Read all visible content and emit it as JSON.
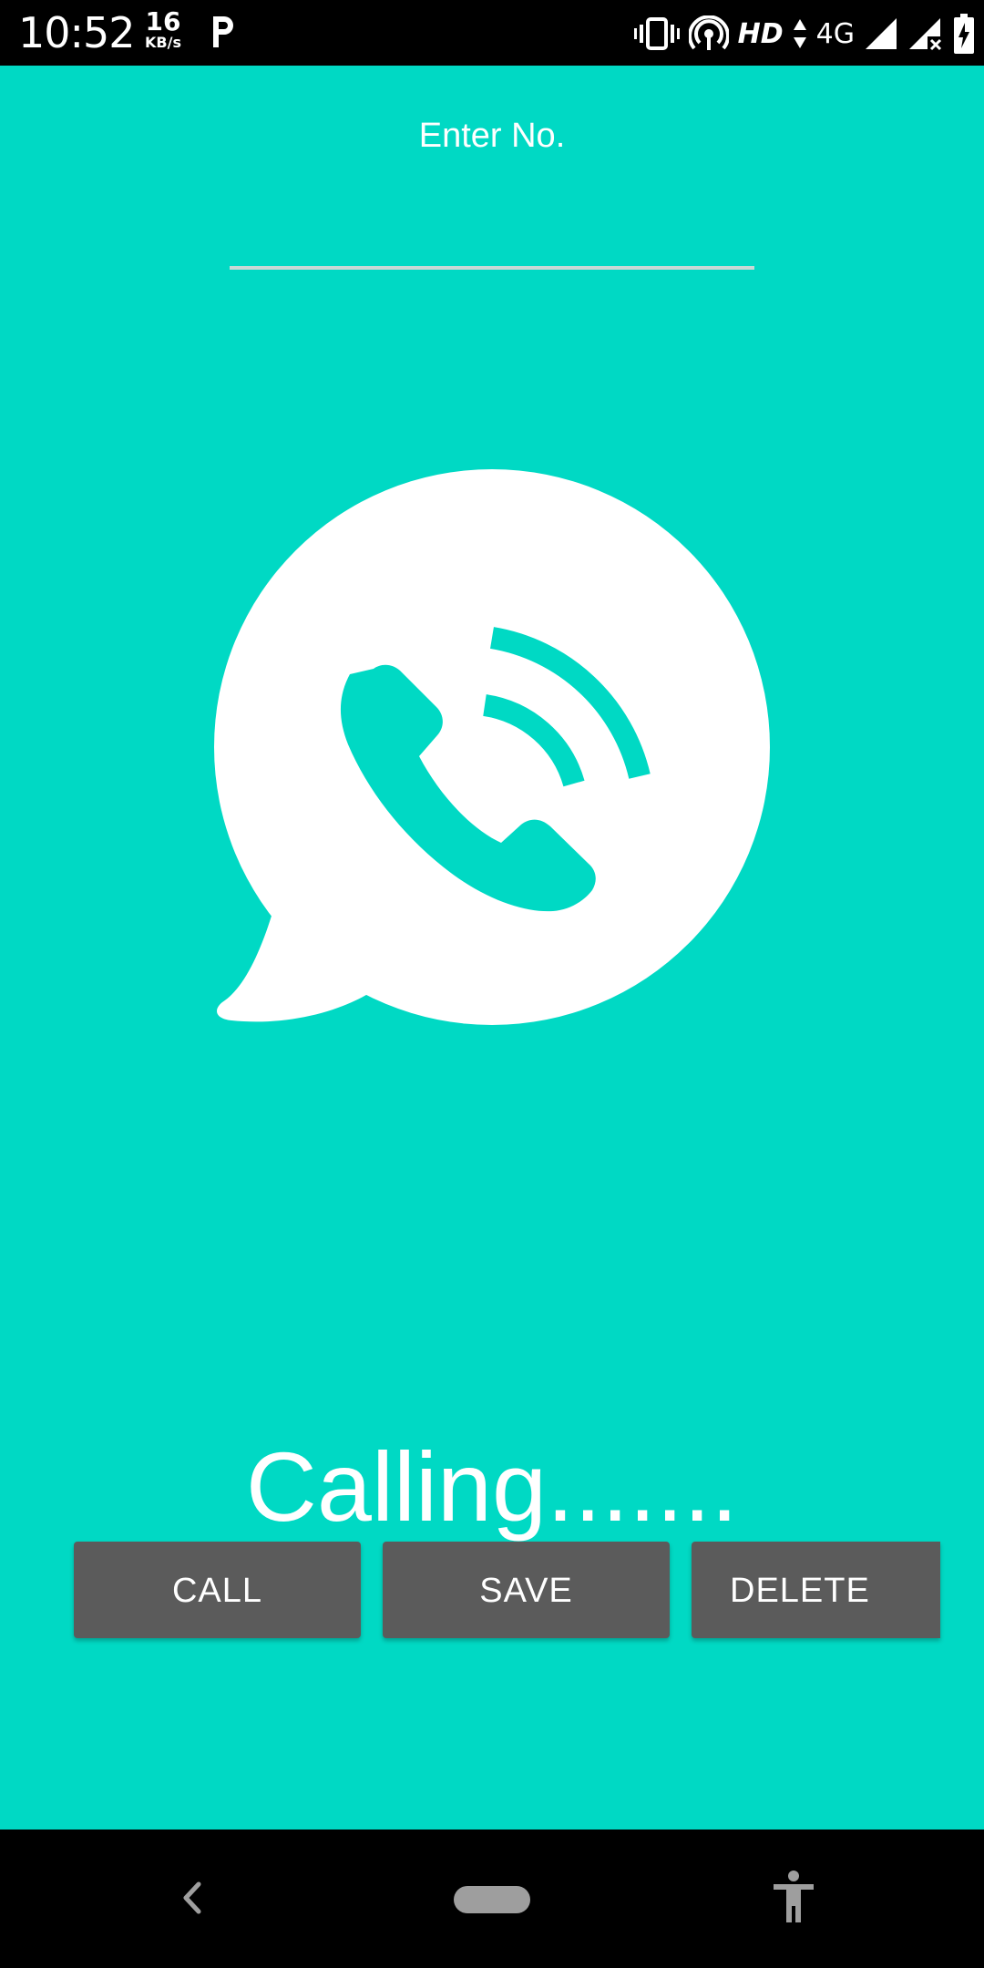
{
  "status_bar": {
    "time": "10:52",
    "net_speed_value": "16",
    "net_speed_unit": "KB/s",
    "hd_label": "HD",
    "network_label": "4G",
    "icons": [
      "p-icon",
      "vibrate-icon",
      "hotspot-icon",
      "data-arrows-icon",
      "signal-icon",
      "signal-no-data-icon",
      "battery-charging-icon"
    ]
  },
  "app": {
    "background_color": "#00D9C4",
    "input_label": "Enter No.",
    "input_value": "",
    "illustration": "phone-call-bubble-icon",
    "status_text": "Calling.......",
    "buttons": {
      "call": "CALL",
      "save": "SAVE",
      "delete": "DELETE"
    },
    "button_color": "#5B5B5B"
  },
  "nav_bar": {
    "icons": [
      "back-icon",
      "home-pill",
      "accessibility-icon"
    ]
  }
}
